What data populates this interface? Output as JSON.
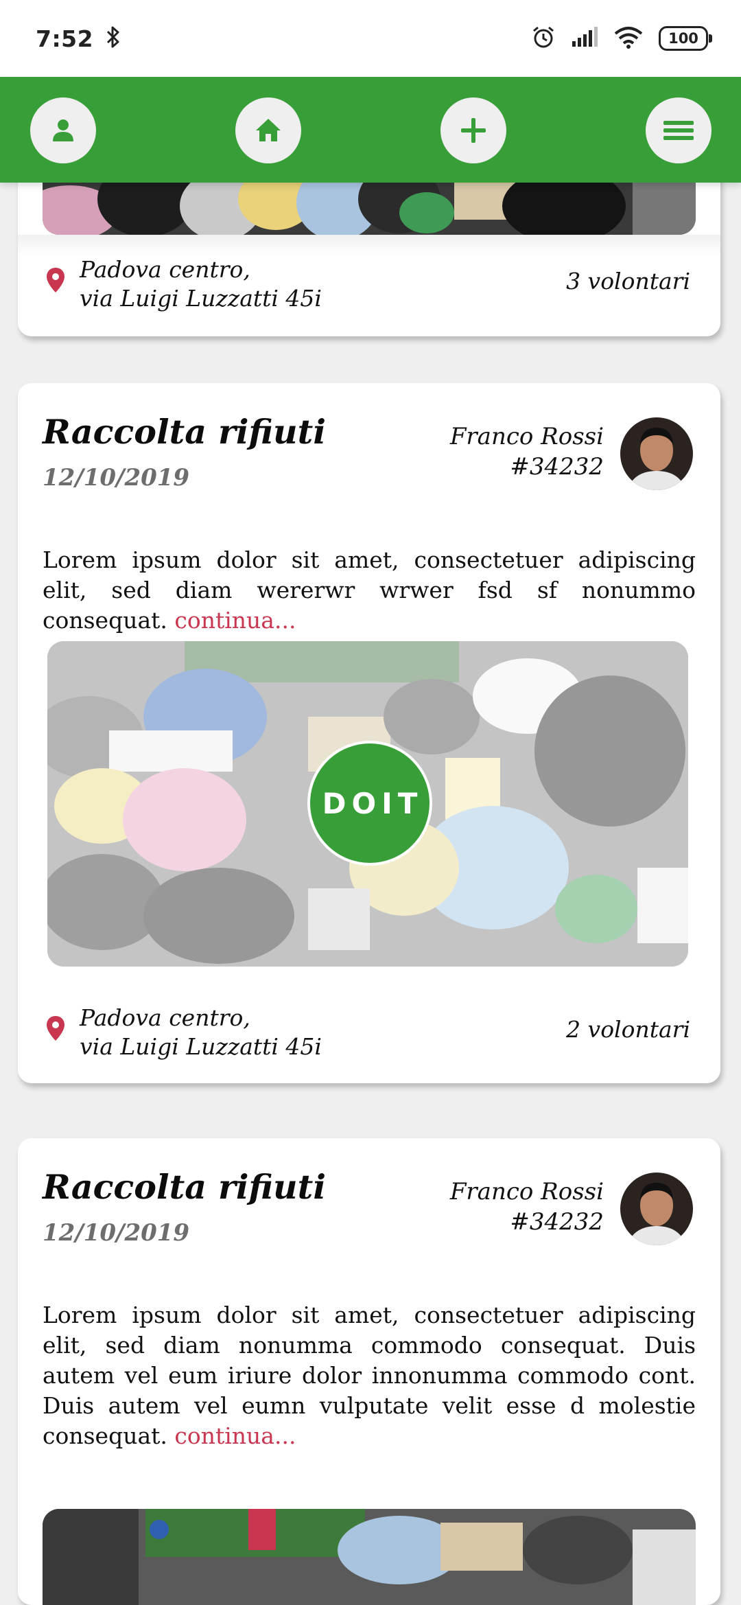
{
  "status_bar": {
    "time": "7:52",
    "battery": "100"
  },
  "nav": {
    "profile_icon": "user-icon",
    "home_icon": "home-icon",
    "add_icon": "plus-icon",
    "menu_icon": "hamburger-icon",
    "color": "#379e38"
  },
  "cards": [
    {
      "location_line1": "Padova centro,",
      "location_line2": "via Luigi Luzzatti 45i",
      "volunteers": "3 volontari"
    },
    {
      "title": "Raccolta rifiuti",
      "date": "12/10/2019",
      "author_name": "Franco Rossi",
      "author_id": "#34232",
      "description": "Lorem ipsum dolor sit amet, consectetuer adipiscing elit, sed diam wererwr wrwer fsd sf nonummo consequat.",
      "more_link": "continua...",
      "doit_label": "DOIT",
      "location_line1": "Padova centro,",
      "location_line2": "via Luigi Luzzatti 45i",
      "volunteers": "2 volontari"
    },
    {
      "title": "Raccolta rifiuti",
      "date": "12/10/2019",
      "author_name": "Franco Rossi",
      "author_id": "#34232",
      "description": "Lorem ipsum dolor sit amet, consectetuer adipiscing elit, sed diam nonumma commodo consequat. Duis autem vel eum iriure dolor innonumma commodo cont. Duis autem vel eumn vulputate velit esse d molestie consequat.",
      "more_link": "continua..."
    }
  ],
  "colors": {
    "accent_green": "#379e38",
    "link_red": "#c8374f",
    "pin_red": "#c8374f"
  }
}
